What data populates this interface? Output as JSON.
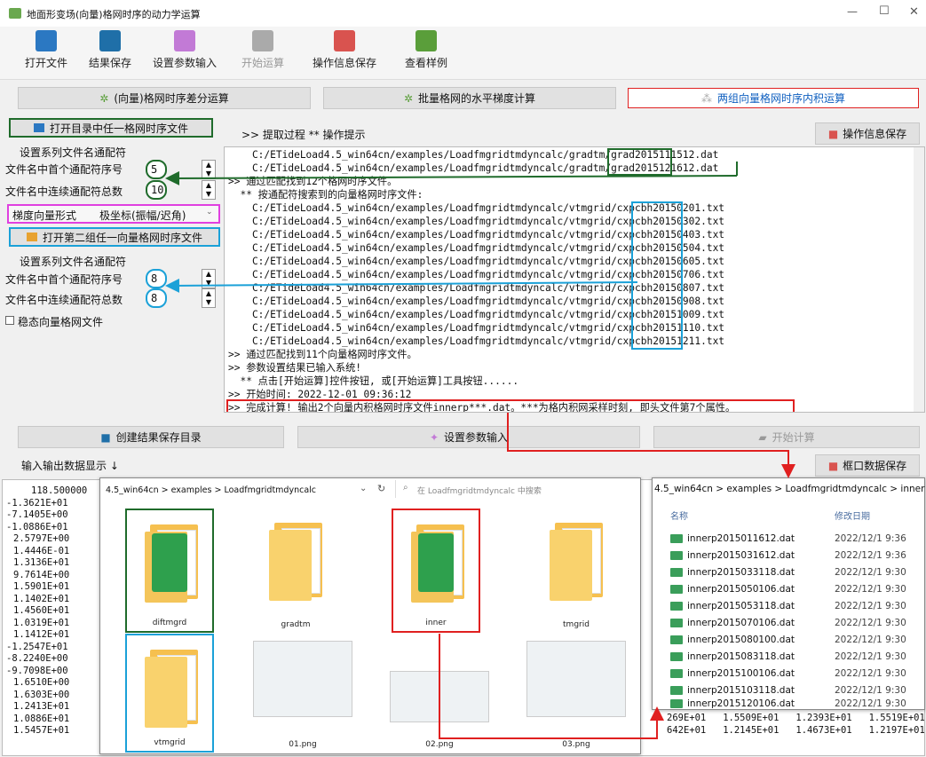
{
  "window": {
    "title": "地面形变场(向量)格网时序的动力学运算",
    "minimize": "—",
    "maximize": "☐",
    "close": "✕"
  },
  "toolbar": {
    "open_file": "打开文件",
    "save_result": "结果保存",
    "set_params": "设置参数输入",
    "start_calc": "开始运算",
    "save_log": "操作信息保存",
    "view_example": "查看样例"
  },
  "modes": {
    "diff": "(向量)格网时序差分运算",
    "gradient": "批量格网的水平梯度计算",
    "inner": "两组向量格网时序内积运算"
  },
  "left": {
    "open_dir_btn": "打开目录中任一格网时序文件",
    "group1_title": "设置系列文件名通配符",
    "first_index_label": "文件名中首个通配符序号",
    "first_index_value": "5",
    "count_label": "文件名中连续通配符总数",
    "count_value": "10",
    "gradient_form_label": "梯度向量形式",
    "gradient_form_value": "极坐标(振幅/迟角)",
    "open_second_btn": "打开第二组任一向量格网时序文件",
    "group2_title": "设置系列文件名通配符",
    "first_index_label2": "文件名中首个通配符序号",
    "first_index_value2": "8",
    "count_label2": "文件名中连续通配符总数",
    "count_value2": "8",
    "steady_label": "稳态向量格网文件"
  },
  "log_header": {
    "process": ">> 提取过程  ** 操作提示",
    "save_btn": "操作信息保存"
  },
  "log_lines": [
    "    C:/ETideLoad4.5_win64cn/examples/Loadfmgridtmdyncalc/gradtm/grad2015111512.dat",
    "    C:/ETideLoad4.5_win64cn/examples/Loadfmgridtmdyncalc/gradtm/grad2015121612.dat",
    ">> 通过匹配找到12个格网时序文件。",
    "  ** 按通配符搜索到的向量格网时序文件:",
    "    C:/ETideLoad4.5_win64cn/examples/Loadfmgridtmdyncalc/vtmgrid/cxpcbh20150201.txt",
    "    C:/ETideLoad4.5_win64cn/examples/Loadfmgridtmdyncalc/vtmgrid/cxpcbh20150302.txt",
    "    C:/ETideLoad4.5_win64cn/examples/Loadfmgridtmdyncalc/vtmgrid/cxpcbh20150403.txt",
    "    C:/ETideLoad4.5_win64cn/examples/Loadfmgridtmdyncalc/vtmgrid/cxpcbh20150504.txt",
    "    C:/ETideLoad4.5_win64cn/examples/Loadfmgridtmdyncalc/vtmgrid/cxpcbh20150605.txt",
    "    C:/ETideLoad4.5_win64cn/examples/Loadfmgridtmdyncalc/vtmgrid/cxpcbh20150706.txt",
    "    C:/ETideLoad4.5_win64cn/examples/Loadfmgridtmdyncalc/vtmgrid/cxpcbh20150807.txt",
    "    C:/ETideLoad4.5_win64cn/examples/Loadfmgridtmdyncalc/vtmgrid/cxpcbh20150908.txt",
    "    C:/ETideLoad4.5_win64cn/examples/Loadfmgridtmdyncalc/vtmgrid/cxpcbh20151009.txt",
    "    C:/ETideLoad4.5_win64cn/examples/Loadfmgridtmdyncalc/vtmgrid/cxpcbh20151110.txt",
    "    C:/ETideLoad4.5_win64cn/examples/Loadfmgridtmdyncalc/vtmgrid/cxpcbh20151211.txt",
    ">> 通过匹配找到11个向量格网时序文件。",
    ">> 参数设置结果已输入系统!",
    "  ** 点击[开始运算]控件按钮, 或[开始运算]工具按钮......",
    ">> 开始时间: 2022-12-01 09:36:12",
    ">> 完成计算! 输出2个向量内积格网时序文件innerp***.dat。***为格内积网采样时刻, 即头文件第7个属性。"
  ],
  "actions": {
    "create_dir": "创建结果保存目录",
    "set_params": "设置参数输入",
    "start": "开始计算"
  },
  "io": {
    "title": "输入输出数据显示 ↓",
    "save_btn": "框口数据保存"
  },
  "data_column": [
    "118.500000",
    "-1.3621E+01",
    "-7.1405E+00",
    "-1.0886E+01",
    "2.5797E+00",
    "1.4446E-01",
    "1.3136E+01",
    "9.7614E+00",
    "1.5901E+01",
    "1.1402E+01",
    "1.4560E+01",
    "1.0319E+01",
    "1.1412E+01",
    "-1.2547E+01",
    "-8.2240E+00",
    "-9.7098E+00",
    "1.6510E+00",
    "1.6303E+00",
    "1.2413E+01",
    "1.0886E+01",
    "1.5457E+01"
  ],
  "bottom_values": [
    "269E+01   1.5509E+01   1.2393E+01   1.5519E+01",
    "642E+01   1.2145E+01   1.4673E+01   1.2197E+01"
  ],
  "explorer1": {
    "path": "4.5_win64cn  >  examples  >  Loadfmgridtmdyncalc",
    "search_placeholder": "在 Loadfmgridtmdyncalc 中搜索",
    "items": [
      "diftmgrd",
      "gradtm",
      "inner",
      "tmgrid",
      "vtmgrid",
      "01.png",
      "02.png",
      "03.png"
    ]
  },
  "explorer2": {
    "path": "4.5_win64cn  >  examples  >  Loadfmgridtmdyncalc  >  inner",
    "col_name": "名称",
    "col_date": "修改日期",
    "files": [
      {
        "name": "innerp2015011612.dat",
        "date": "2022/12/1 9:36"
      },
      {
        "name": "innerp2015031612.dat",
        "date": "2022/12/1 9:36"
      },
      {
        "name": "innerp2015033118.dat",
        "date": "2022/12/1 9:30"
      },
      {
        "name": "innerp2015050106.dat",
        "date": "2022/12/1 9:30"
      },
      {
        "name": "innerp2015053118.dat",
        "date": "2022/12/1 9:30"
      },
      {
        "name": "innerp2015070106.dat",
        "date": "2022/12/1 9:30"
      },
      {
        "name": "innerp2015080100.dat",
        "date": "2022/12/1 9:30"
      },
      {
        "name": "innerp2015083118.dat",
        "date": "2022/12/1 9:30"
      },
      {
        "name": "innerp2015100106.dat",
        "date": "2022/12/1 9:30"
      },
      {
        "name": "innerp2015103118.dat",
        "date": "2022/12/1 9:30"
      },
      {
        "name": "innerp2015120106.dat",
        "date": "2022/12/1 9:30"
      }
    ]
  },
  "colors": {
    "green": "#1f6b2b",
    "blue": "#1ba1d8",
    "red": "#e02020",
    "magenta": "#e040e0"
  }
}
